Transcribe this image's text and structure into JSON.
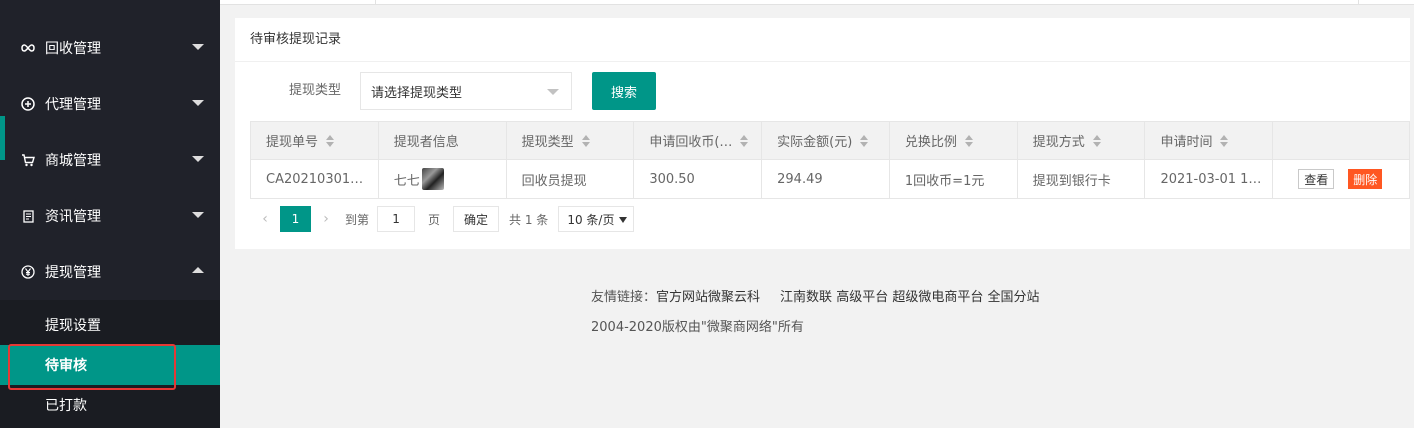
{
  "sidebar": {
    "items": [
      {
        "label": "回收管理",
        "icon": "infinity-icon"
      },
      {
        "label": "代理管理",
        "icon": "plus-circle-icon"
      },
      {
        "label": "商城管理",
        "icon": "cart-icon"
      },
      {
        "label": "资讯管理",
        "icon": "document-icon"
      },
      {
        "label": "提现管理",
        "icon": "yen-icon"
      }
    ],
    "sub_items": [
      "提现设置",
      "待审核",
      "已打款"
    ],
    "active_sub": "待审核"
  },
  "card": {
    "title": "待审核提现记录"
  },
  "filter": {
    "label": "提现类型",
    "select_placeholder": "请选择提现类型",
    "search_label": "搜索"
  },
  "table": {
    "headers": [
      "提现单号",
      "提现者信息",
      "提现类型",
      "申请回收币(…",
      "实际金额(元)",
      "兑换比例",
      "提现方式",
      "申请时间",
      ""
    ],
    "rows": [
      {
        "order_no": "CA20210301…",
        "user": "七七",
        "type": "回收员提现",
        "coins": "300.50",
        "amount": "294.49",
        "ratio": "1回收币=1元",
        "method": "提现到银行卡",
        "time": "2021-03-01 1…",
        "view_label": "查看",
        "delete_label": "删除"
      }
    ]
  },
  "pagination": {
    "current_page": "1",
    "goto_prefix": "到第",
    "goto_value": "1",
    "goto_suffix": "页",
    "confirm_label": "确定",
    "total": "共 1 条",
    "page_size": "10 条/页"
  },
  "footer": {
    "links_prefix": "友情链接：",
    "links": [
      "官方网站微聚云科",
      "江南数联",
      "高级平台",
      "超级微电商平台",
      "全国分站"
    ],
    "copyright": "2004-2020版权由\"微聚商网络\"所有"
  },
  "colors": {
    "accent": "#009688",
    "sidebar_bg": "#20222a",
    "danger": "#ff5722",
    "highlight_outline": "#e53935"
  }
}
